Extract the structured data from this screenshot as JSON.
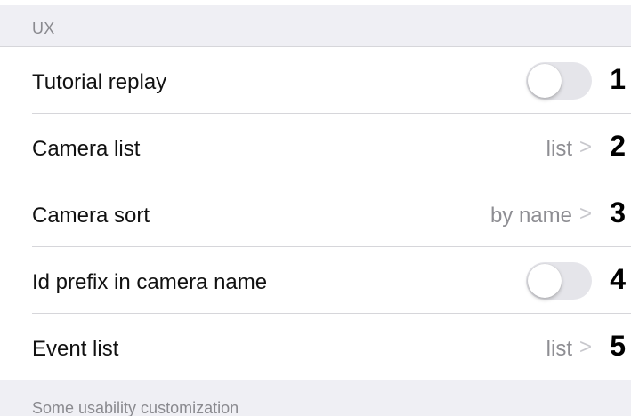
{
  "section": {
    "header": "UX",
    "footer": "Some usability customization"
  },
  "rows": [
    {
      "label": "Tutorial replay",
      "type": "toggle",
      "value": "off",
      "callout": "1"
    },
    {
      "label": "Camera list",
      "type": "disclosure",
      "value": "list",
      "chevron": ">",
      "callout": "2"
    },
    {
      "label": "Camera sort",
      "type": "disclosure",
      "value": "by name",
      "chevron": ">",
      "callout": "3"
    },
    {
      "label": "Id prefix in camera name",
      "type": "toggle",
      "value": "off",
      "callout": "4"
    },
    {
      "label": "Event list",
      "type": "disclosure",
      "value": "list",
      "chevron": ">",
      "callout": "5"
    }
  ],
  "colors": {
    "background_group": "#efeff4",
    "separator": "#d6d6da",
    "secondary_text": "#8e8e93",
    "toggle_off": "#e5e5ea"
  }
}
